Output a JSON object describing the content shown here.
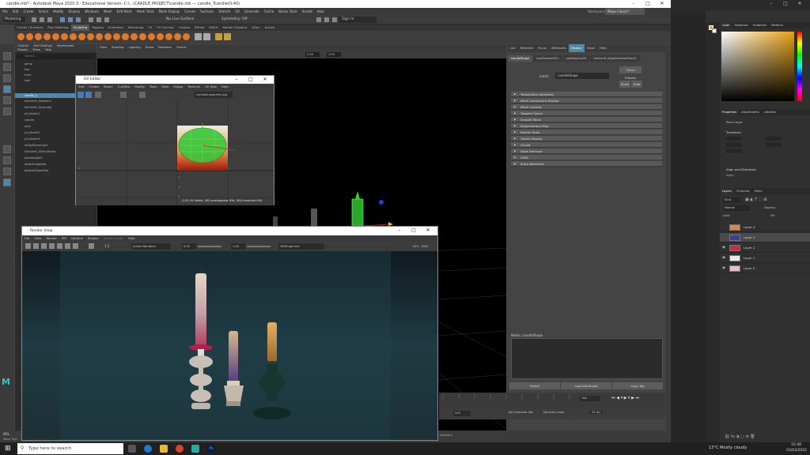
{
  "maya": {
    "title": "candle.mb* - Autodesk Maya 2020.3 - Educational Version: C:\\...\\CARDLE PROJECT\\candle.mb --- candle_Tcandle(0:40)",
    "menus": [
      "File",
      "Edit",
      "Create",
      "Select",
      "Modify",
      "Display",
      "Windows",
      "Mesh",
      "Edit Mesh",
      "Mesh Tools",
      "Mesh Display",
      "Curves",
      "Surfaces",
      "Deform",
      "UV",
      "Generate",
      "Cache",
      "Bonus Tools",
      "Arnold",
      "Help"
    ],
    "mode": "Modeling",
    "no_live_surface": "No Live Surface",
    "symmetry": "Symmetry: Off",
    "signin": "Sign In",
    "workspace_label": "Workspace:",
    "workspace": "Maya Classic*",
    "shelf_tabs": [
      "Curves / Surfaces",
      "Poly Modeling",
      "Sculpting",
      "Rigging",
      "Animation",
      "Rendering",
      "FX",
      "FX Caching",
      "Custom",
      "Bifrost",
      "MASH",
      "Motion Graphics",
      "XGen",
      "Arnold"
    ],
    "active_shelf": 2,
    "outliner_menus": [
      "Outliner",
      "Xref Settings",
      "Hypershade",
      "Display",
      "Show",
      "Help"
    ],
    "outliner_search": "Search...",
    "outliner_items": [
      "persp",
      "top",
      "front",
      "side",
      "candle_1",
      "kitchenR_lit/sketch",
      "kitchenR_lit/candle",
      "pCylinder1",
      "candle",
      "wick",
      "pCylinder2",
      "pCylinder3",
      "aiSkyDomeLight",
      "kitchenR_lit/SkyDome",
      "aiAreaLight1",
      "defaultLightSet",
      "defaultObjectSet"
    ],
    "outliner_selected": 4,
    "viewport_menus": [
      "View",
      "Shading",
      "Lighting",
      "Show",
      "Renderer",
      "Panels"
    ],
    "viewport_values": [
      "0.00",
      "1.00"
    ],
    "attr_menus": [
      "List",
      "Selected",
      "Focus",
      "Attributes",
      "Display",
      "Show",
      "Help"
    ],
    "attr_active": 4,
    "attr_tabs": [
      "candleShape",
      "polyTweakUV21",
      "polyMapCut20",
      "kitchenR_lit/polySmoothFace2"
    ],
    "mesh_label": "mesh:",
    "mesh_value": "candleShape",
    "focus_btn": "Focus",
    "presets_btn": "Presets",
    "show_btn": "Show",
    "hide_btn": "Hide",
    "attr_sections": [
      "Tessellation Attributes",
      "Mesh Component Display",
      "Mesh Controls",
      "Tangent Space",
      "Smooth Mesh",
      "Displacement Map",
      "Render Stats",
      "Object Display",
      "Arnold",
      "Node Behavior",
      "UUID",
      "Extra Attributes"
    ],
    "notes_label": "Notes: candleShape",
    "select_btn": "Select",
    "load_attr_btn": "Load Attributes",
    "copy_tab_btn": "Copy Tab",
    "time_start": "1",
    "time_current": "160",
    "range_end": "200",
    "no_char_set": "No Character Set",
    "no_anim_layer": "No Anim Layer",
    "fps": "24 fps",
    "mel_label": "MEL",
    "status_msg": "statistics",
    "footer_text": "Move Tool"
  },
  "uv_editor": {
    "title": "UV Editor",
    "menus": [
      "Edit",
      "Create",
      "Select",
      "Cut/Sew",
      "Modify",
      "Tools",
      "View",
      "Image",
      "Textures",
      "UV Sets",
      "Help"
    ],
    "texture_name": "candleorangemini.jpg",
    "status": "(1/1) UV shells, (00) overlapping UVs, (00) reversed UVs",
    "axis_ticks": [
      "-1",
      "0",
      "1",
      "2",
      "3",
      "4"
    ]
  },
  "render_view": {
    "title": "Render View",
    "menus": [
      "File",
      "View",
      "Render",
      "IPR",
      "Options",
      "Display",
      "Render Layer",
      "Help"
    ],
    "renderer": "Arnold Renderer",
    "exposure": "0.00",
    "gamma": "1.00",
    "color_space": "sRGB gamma",
    "ratio": "1:1",
    "size_info": "470 : 2000"
  },
  "photoshop": {
    "color_tabs": [
      "Color",
      "Swatches",
      "Gradients",
      "Patterns"
    ],
    "props_tabs": [
      "Properties",
      "Adjustments",
      "Libraries"
    ],
    "pixel_layer": "Pixel Layer",
    "transform_label": "Transform",
    "align_label": "Align and Distribute",
    "align_sub": "Align:",
    "layers_tabs": [
      "Layers",
      "Channels",
      "Paths"
    ],
    "kind_label": "Kind",
    "blend_mode": "Normal",
    "opacity_label": "Opacity:",
    "lock_label": "Lock:",
    "fill_label": "Fill:",
    "layers": [
      {
        "name": "Layer 4",
        "visible": false,
        "color": "#d4884a"
      },
      {
        "name": "Layer 3",
        "visible": false,
        "color": "#3a3f8a"
      },
      {
        "name": "Layer 2",
        "visible": true,
        "color": "#c03048"
      },
      {
        "name": "Layer 1",
        "visible": true,
        "color": "#e8e8e8"
      },
      {
        "name": "Layer 0",
        "visible": true,
        "color": "#e8c0c0"
      }
    ],
    "selected_layer": 1,
    "fg_color": "#e8b020",
    "bg_color": "#ffffff"
  },
  "taskbar": {
    "search_placeholder": "Type here to search",
    "weather": "13°C  Mostly cloudy",
    "time": "15:48",
    "date": "03/03/2022"
  }
}
